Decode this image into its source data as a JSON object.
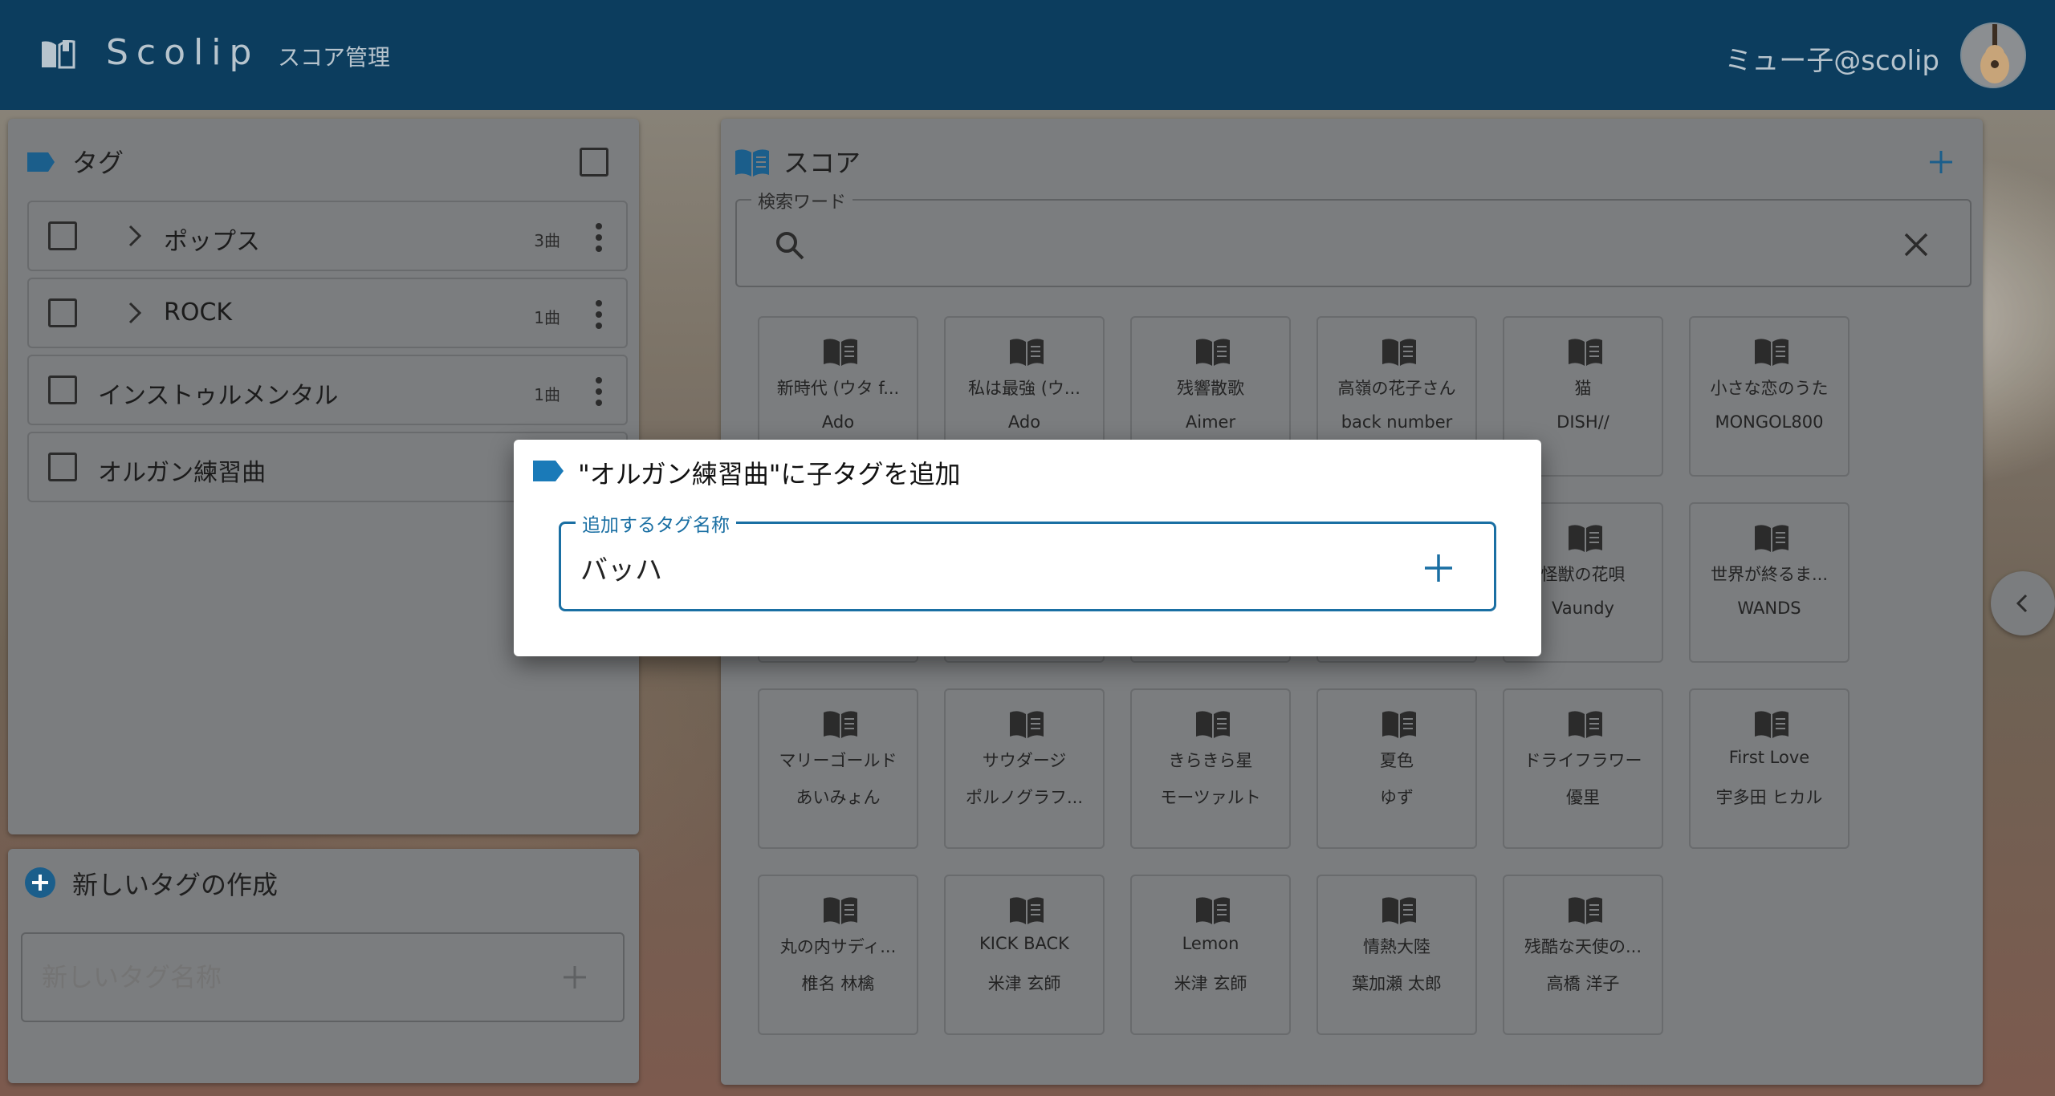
{
  "header": {
    "brand": "Scolip",
    "nav_link": "スコア管理",
    "user_name": "ミュー子@scolip"
  },
  "tag_panel": {
    "title": "タグ",
    "items": [
      {
        "label": "ポップス",
        "count": "3曲",
        "expandable": true
      },
      {
        "label": "ROCK",
        "count": "1曲",
        "expandable": true
      },
      {
        "label": "インストゥルメンタル",
        "count": "1曲",
        "expandable": false
      },
      {
        "label": "オルガン練習曲",
        "count": "",
        "expandable": false
      }
    ]
  },
  "new_tag_panel": {
    "title": "新しいタグの作成",
    "placeholder": "新しいタグ名称"
  },
  "score_panel": {
    "title": "スコア",
    "search_legend": "検索ワード",
    "scores": [
      {
        "title": "新時代 (ウタ f...",
        "artist": "Ado"
      },
      {
        "title": "私は最強 (ウ...",
        "artist": "Ado"
      },
      {
        "title": "残響散歌",
        "artist": "Aimer"
      },
      {
        "title": "高嶺の花子さん",
        "artist": "back number"
      },
      {
        "title": "猫",
        "artist": "DISH//"
      },
      {
        "title": "小さな恋のうた",
        "artist": "MONGOL800"
      },
      {
        "title": "",
        "artist": ""
      },
      {
        "title": "",
        "artist": ""
      },
      {
        "title": "",
        "artist": ""
      },
      {
        "title": "",
        "artist": ""
      },
      {
        "title": "怪獣の花唄",
        "artist": "Vaundy"
      },
      {
        "title": "世界が終るま...",
        "artist": "WANDS"
      },
      {
        "title": "マリーゴールド",
        "artist": "あいみょん"
      },
      {
        "title": "サウダージ",
        "artist": "ポルノグラフ..."
      },
      {
        "title": "きらきら星",
        "artist": "モーツァルト"
      },
      {
        "title": "夏色",
        "artist": "ゆず"
      },
      {
        "title": "ドライフラワー",
        "artist": "優里"
      },
      {
        "title": "First Love",
        "artist": "宇多田 ヒカル"
      },
      {
        "title": "丸の内サディ...",
        "artist": "椎名 林檎"
      },
      {
        "title": "KICK BACK",
        "artist": "米津 玄師"
      },
      {
        "title": "Lemon",
        "artist": "米津 玄師"
      },
      {
        "title": "情熱大陸",
        "artist": "葉加瀬 太郎"
      },
      {
        "title": "残酷な天使の...",
        "artist": "高橋 洋子"
      }
    ]
  },
  "dialog": {
    "title": "\"オルガン練習曲\"に子タグを追加",
    "field_label": "追加するタグ名称",
    "input_value": "バッハ"
  },
  "colors": {
    "header_bg": "#0b3d5e",
    "accent": "#1a6fa3",
    "tag_icon": "#1a7ab8"
  },
  "icons": [
    "book-open-icon",
    "tag-icon",
    "chevron-right-icon",
    "more-vert-icon",
    "plus-icon",
    "search-icon",
    "close-icon",
    "chevron-left-icon",
    "plus-circle-icon"
  ]
}
